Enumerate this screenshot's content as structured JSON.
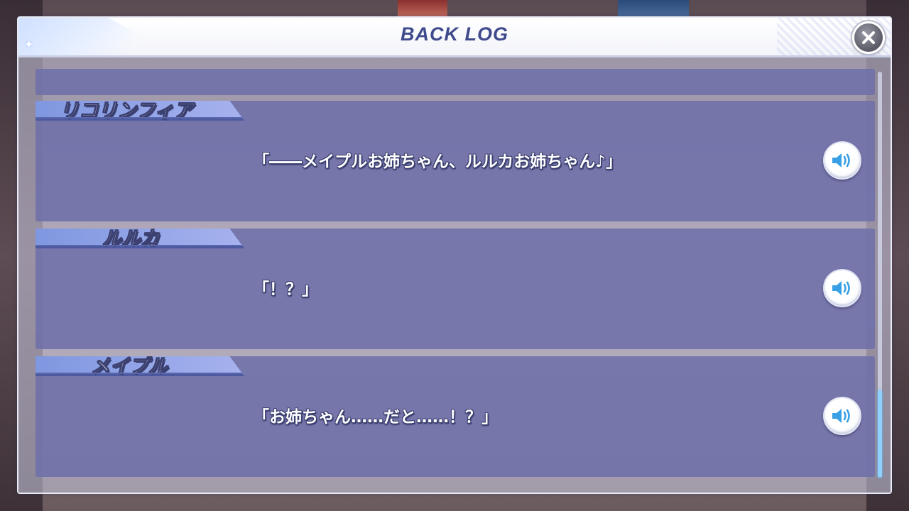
{
  "header": {
    "title": "BACK LOG",
    "close_icon": "close-icon"
  },
  "entries": [
    {
      "speaker": "リコリンフィア",
      "text": "「――メイプルお姉ちゃん、ルルカお姉ちゃん♪」",
      "voice_icon": "speaker-icon"
    },
    {
      "speaker": "ルルカ",
      "text": "「！？」",
      "voice_icon": "speaker-icon"
    },
    {
      "speaker": "メイプル",
      "text": "「お姉ちゃん……だと……！？」",
      "voice_icon": "speaker-icon"
    }
  ],
  "scroll": {
    "position": 1.0
  },
  "colors": {
    "title": "#3f4a8c",
    "entry_bg": "#6e70aa",
    "name_tag": "#8fa3e6",
    "scroll_thumb": "#8fd0ff",
    "voice_icon": "#3aa0e6"
  }
}
